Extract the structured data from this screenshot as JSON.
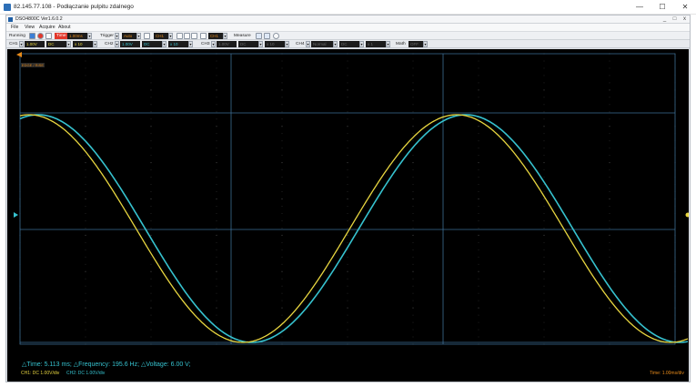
{
  "remote_window": {
    "title": "82.145.77.108 - Podłączanie pulpitu zdalnego",
    "controls": {
      "minimize": "—",
      "maximize": "☐",
      "close": "✕"
    }
  },
  "app": {
    "title": "DSO4800C Ver1.6.0.2",
    "menu": [
      "File",
      "View",
      "Acquire",
      "About"
    ]
  },
  "toolbar": {
    "status": "Running",
    "time_label": "Time",
    "time_value": "1.00ms",
    "trigger_label": "Trigger",
    "trigger_mode": "Auto",
    "trigger_source": "CH1",
    "channel_select": "CH1",
    "measure_label": "Measure"
  },
  "channels": [
    {
      "label": "CH1",
      "volts": "1.00V",
      "coupling": "DC",
      "probe": "x 10",
      "color": "#e8d640"
    },
    {
      "label": "CH2",
      "volts": "1.00V",
      "coupling": "DC",
      "probe": "x 10",
      "color": "#36c2cf"
    },
    {
      "label": "CH3",
      "volts": "1.00V",
      "coupling": "DC",
      "probe": "x 10",
      "color": "#6a6a6a"
    },
    {
      "label": "CH4",
      "volts": "Normal",
      "coupling": "DC",
      "probe": "x 1",
      "color": "#6a6a6a"
    }
  ],
  "math": {
    "label": "Math",
    "value": "OFF"
  },
  "scope": {
    "grid_color": "#3d6e94",
    "tag": "EDGE / RISE",
    "measurement": "△Time: 5.113 ms; △Frequency: 195.6 Hz; △Voltage: 6.00 V;",
    "ch1_info": "CH1: DC 1.00V/div",
    "ch2_info": "CH2: DC 1.00V/div",
    "timebase_info": "Time: 1.00ms/div",
    "ch1_color": "#e8d640",
    "ch2_color": "#36c2cf",
    "info_color": "#e68a1a"
  }
}
